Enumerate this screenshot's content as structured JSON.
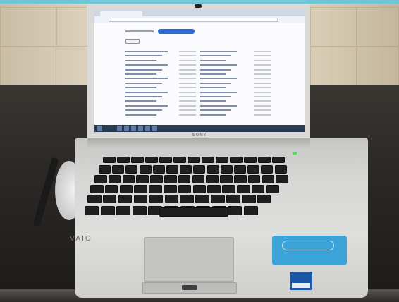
{
  "photo": {
    "subject": "",
    "brand_lid": "SONY",
    "brand_palmrest": "VAIO",
    "colors": {
      "wall": "#e2d7c2",
      "table": "#2b2826",
      "laptop_body": "#d6d6d4",
      "keys": "#1f1f21",
      "screen_accent": "#2a6bd6",
      "sticker": "#3ca3d8",
      "intel_badge": "#1b57a6"
    }
  }
}
